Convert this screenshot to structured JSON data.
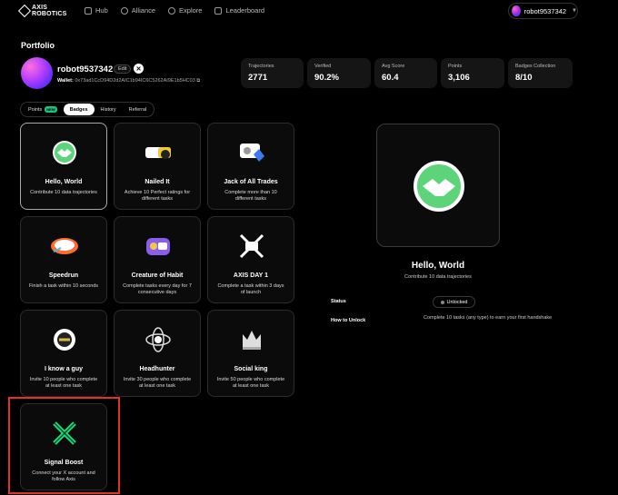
{
  "logo": {
    "line1": "AXIS",
    "line2": "ROBOTICS"
  },
  "nav": [
    {
      "label": "Hub",
      "icon": "grid-icon"
    },
    {
      "label": "Alliance",
      "icon": "people-icon"
    },
    {
      "label": "Explore",
      "icon": "compass-icon"
    },
    {
      "label": "Leaderboard",
      "icon": "trophy-icon"
    }
  ],
  "user": {
    "name": "robot9537342"
  },
  "page": {
    "title": "Portfolio"
  },
  "profile": {
    "username": "robot9537342",
    "edit_label": "Edit",
    "x_label": "✕",
    "wallet_label": "Wallet:",
    "wallet_address": "0x73ad1CcD94D2d2AIC1b94IC6C5262AI9E1b5HC03"
  },
  "stats": [
    {
      "label": "Trajectories",
      "value": "2771"
    },
    {
      "label": "Verified",
      "value": "90.2%"
    },
    {
      "label": "Avg Score",
      "value": "60.4"
    },
    {
      "label": "Points",
      "value": "3,106"
    },
    {
      "label": "Badges Collection",
      "value": "8/10"
    }
  ],
  "tabs": [
    {
      "label": "Points",
      "badge": "NEW"
    },
    {
      "label": "Badges"
    },
    {
      "label": "History"
    },
    {
      "label": "Referral"
    }
  ],
  "badges": [
    {
      "title": "Hello, World",
      "desc": "Contribute 10 data trajectories",
      "icon": "handshake-icon",
      "color": "#5dd47a"
    },
    {
      "title": "Nailed It",
      "desc": "Achieve 10 Perfect ratings for different tasks",
      "icon": "hammer-icon",
      "color": "#f0c93a"
    },
    {
      "title": "Jack of All Trades",
      "desc": "Complete more than 10 different tasks",
      "icon": "tools-icon",
      "color": "#3a7bf0"
    },
    {
      "title": "Speedrun",
      "desc": "Finish a task within 10 seconds",
      "icon": "speed-icon",
      "color": "#ff6b2e"
    },
    {
      "title": "Creature of Habit",
      "desc": "Complete tasks every day for 7 consecutive days",
      "icon": "calendar-icon",
      "color": "#8a5cf0"
    },
    {
      "title": "AXIS DAY 1",
      "desc": "Complete a task within 3 days of launch",
      "icon": "axis-day1-icon",
      "color": "#ffffff"
    },
    {
      "title": "I know a guy",
      "desc": "Invite 10 people who complete at least one task",
      "icon": "medal-icon",
      "color": "#d9b84a"
    },
    {
      "title": "Headhunter",
      "desc": "Invite 30 people who complete at least one task",
      "icon": "target-icon",
      "color": "#dddddd"
    },
    {
      "title": "Social king",
      "desc": "Invite 50 people who complete at least one task",
      "icon": "crown-icon",
      "color": "#dddddd"
    },
    {
      "title": "Signal Boost",
      "desc": "Connect your X account and follow Axis",
      "icon": "x-logo-icon",
      "color": "#19e07a"
    }
  ],
  "detail": {
    "title": "Hello, World",
    "desc": "Contribute 10 data trajectories",
    "status_label": "Status",
    "status_value": "Unlocked",
    "unlock_label": "How to Unlock",
    "unlock_text": "Complete 10 tasks (any type) to earn your first handshake"
  }
}
